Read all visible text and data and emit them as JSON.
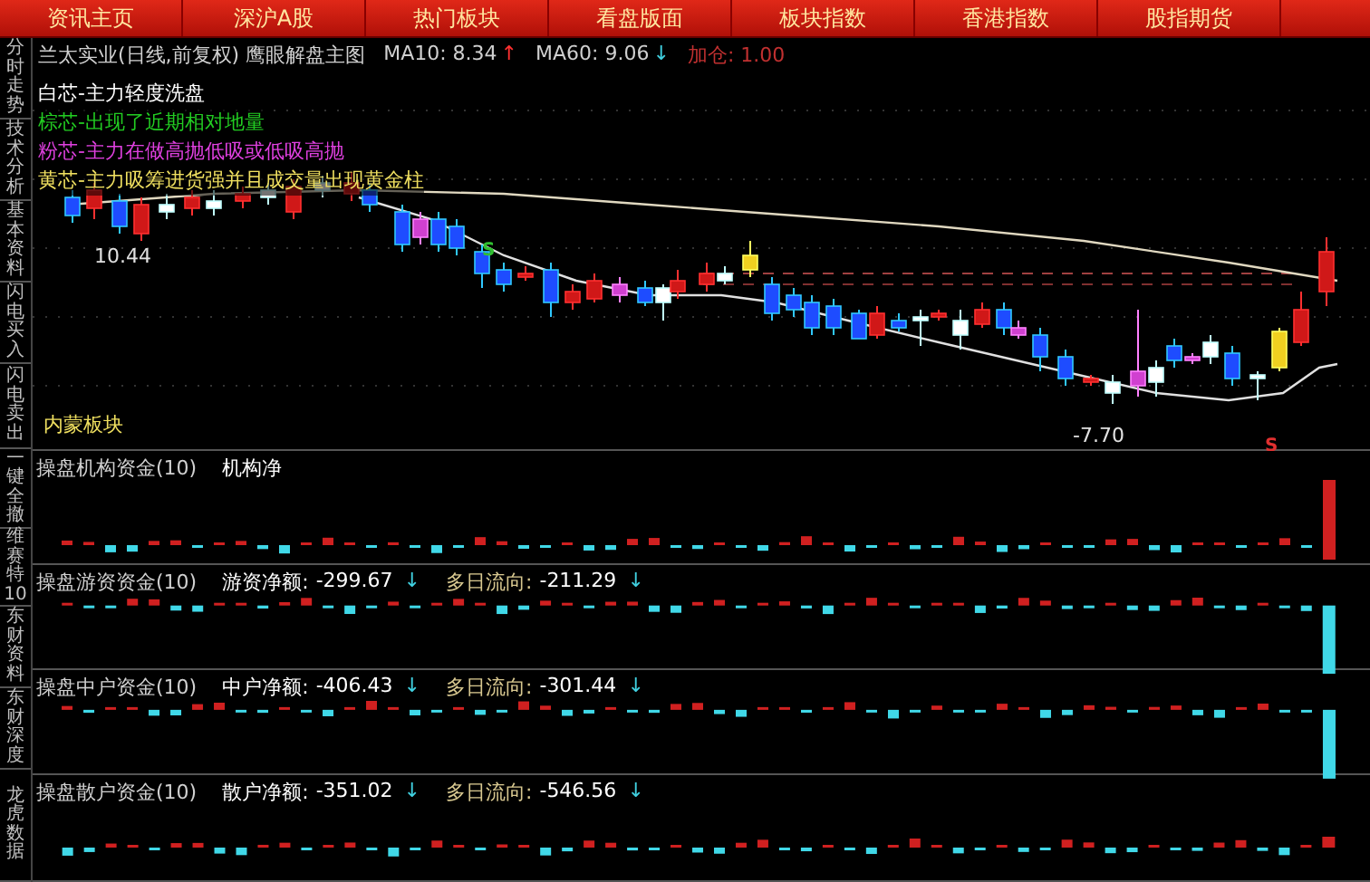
{
  "menu_tabs": [
    {
      "label": "资讯主页"
    },
    {
      "label": "深沪A股"
    },
    {
      "label": "热门板块"
    },
    {
      "label": "看盘版面"
    },
    {
      "label": "板块指数"
    },
    {
      "label": "香港指数"
    },
    {
      "label": "股指期货"
    }
  ],
  "sidebar": {
    "items": [
      {
        "label": "分时走势"
      },
      {
        "label": "技术分析"
      },
      {
        "label": "基本资料"
      },
      {
        "label": "闪电买入"
      },
      {
        "label": "闪电卖出"
      },
      {
        "label": "一键全撤"
      },
      {
        "label": "维赛特10"
      },
      {
        "label": "东财资料"
      },
      {
        "label": "东财深度"
      },
      {
        "label": "龙虎数据"
      }
    ]
  },
  "main_chart": {
    "title": "兰太实业(日线,前复权) 鹰眼解盘主图",
    "indicators": [
      {
        "label": "MA10: 8.34",
        "arrow": "↑",
        "kind": "up"
      },
      {
        "label": "MA60: 9.06",
        "arrow": "↓",
        "kind": "down"
      },
      {
        "label": "加仓: 1.00",
        "kind": "plain"
      }
    ],
    "legend": [
      {
        "text": "白芯-主力轻度洗盘",
        "color": "#ffffff"
      },
      {
        "text": "棕芯-出现了近期相对地量",
        "color": "#22cc22"
      },
      {
        "text": "粉芯-主力在做高抛低吸或低吸高抛",
        "color": "#e040e0"
      },
      {
        "text": "黄芯-主力吸筹进货强并且成交量出现黄金柱",
        "color": "#f0e060"
      }
    ],
    "marks": [
      {
        "text": "10.44",
        "kind": "price"
      },
      {
        "text": "S",
        "kind": "buy"
      },
      {
        "text": "-7.70",
        "kind": "price"
      },
      {
        "text": "S",
        "kind": "sell"
      }
    ],
    "sector": "内蒙板块"
  },
  "panels": [
    {
      "title": "操盘机构资金(10)",
      "readings": [
        {
          "label": "机构净"
        }
      ]
    },
    {
      "title": "操盘游资资金(10)",
      "readings": [
        {
          "label": "游资净额:",
          "value": "-299.67",
          "arrow": "↓"
        },
        {
          "label": "多日流向:",
          "value": "-211.29",
          "arrow": "↓"
        }
      ]
    },
    {
      "title": "操盘中户资金(10)",
      "readings": [
        {
          "label": "中户净额:",
          "value": "-406.43",
          "arrow": "↓"
        },
        {
          "label": "多日流向:",
          "value": "-301.44",
          "arrow": "↓"
        }
      ]
    },
    {
      "title": "操盘散户资金(10)",
      "readings": [
        {
          "label": "散户净额:",
          "value": "-351.02",
          "arrow": "↓"
        },
        {
          "label": "多日流向:",
          "value": "-546.56",
          "arrow": "↓"
        }
      ]
    }
  ]
}
